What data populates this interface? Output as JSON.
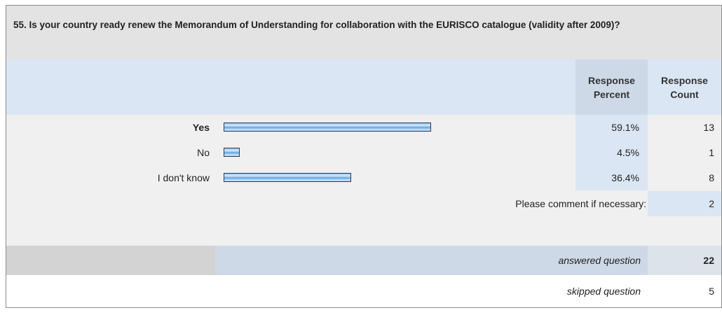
{
  "question": {
    "title": "55. Is your country ready renew the Memorandum of Understanding for collaboration with the EURISCO catalogue (validity after 2009)?"
  },
  "header": {
    "response_percent": "Response Percent",
    "response_count": "Response Count"
  },
  "rows": [
    {
      "label": "Yes",
      "percent": "59.1%",
      "count": "13",
      "fraction": 0.591
    },
    {
      "label": "No",
      "percent": "4.5%",
      "count": "1",
      "fraction": 0.045
    },
    {
      "label": "I don't know",
      "percent": "36.4%",
      "count": "8",
      "fraction": 0.364
    }
  ],
  "comment": {
    "label": "Please comment if necessary:",
    "count": "2"
  },
  "answered": {
    "label": "answered question",
    "count": "22"
  },
  "skipped": {
    "label": "skipped question",
    "count": "5"
  },
  "colors": {
    "header_bg": "#dbe6f4",
    "bar_fill": "#5da5ea"
  }
}
